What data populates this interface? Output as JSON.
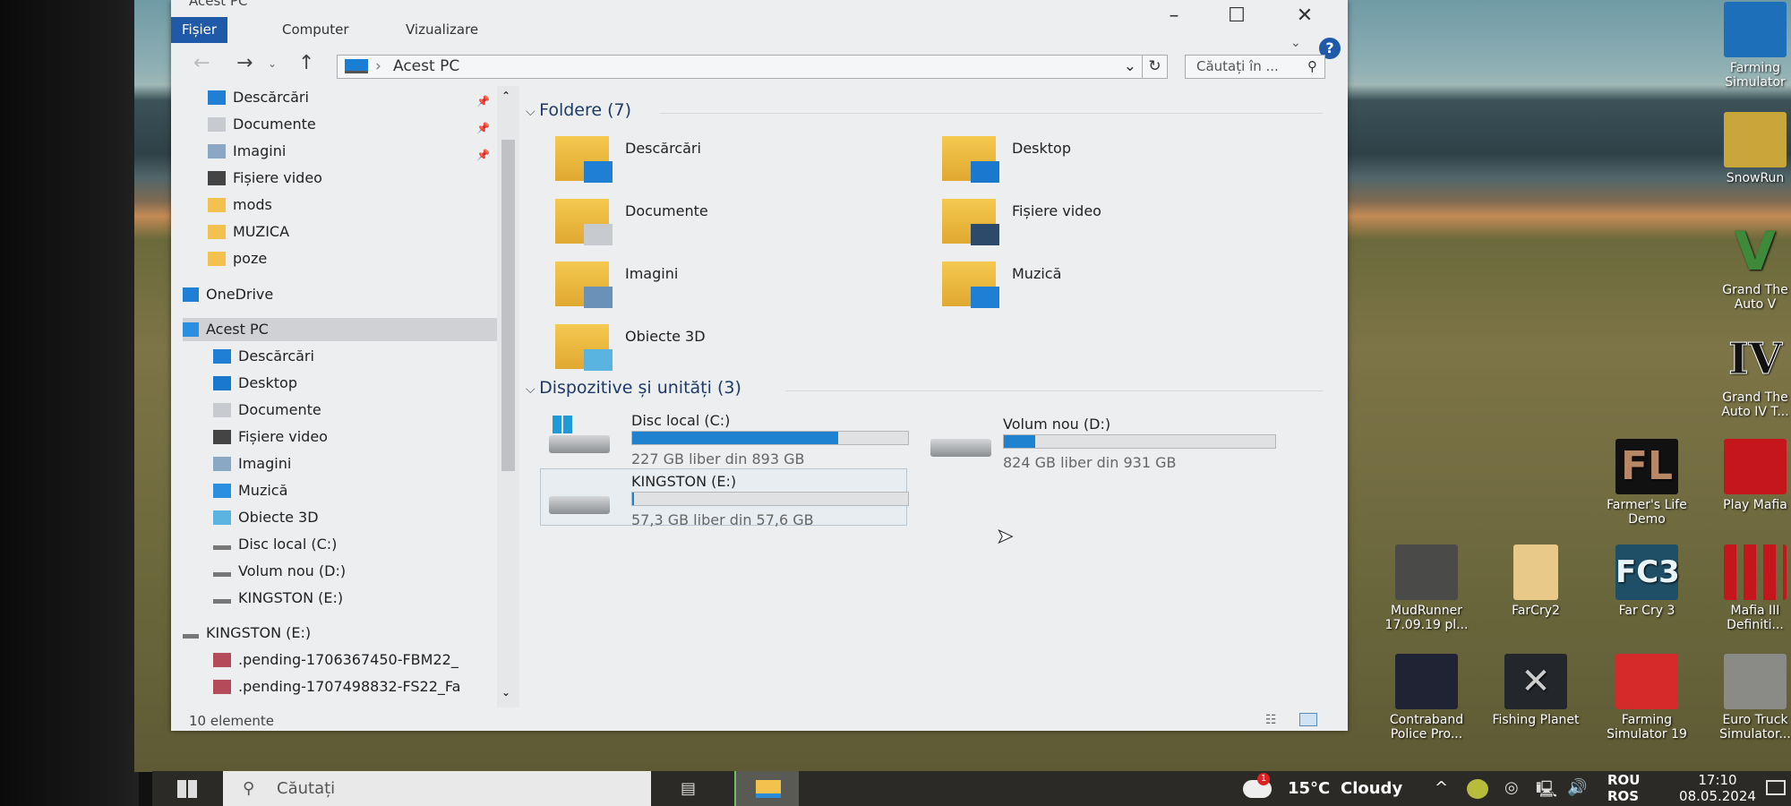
{
  "window": {
    "title": "Acest PC",
    "tabs": [
      {
        "label": "Fișier",
        "active": true
      },
      {
        "label": "Computer"
      },
      {
        "label": "Vizualizare"
      }
    ],
    "address": "Acest PC",
    "search_placeholder": "Căutați în ...",
    "status": "10 elemente"
  },
  "nav": [
    {
      "label": "Descărcări",
      "icon": "download-icon",
      "pinned": true
    },
    {
      "label": "Documente",
      "icon": "documents-icon",
      "pinned": true
    },
    {
      "label": "Imagini",
      "icon": "pictures-icon",
      "pinned": true
    },
    {
      "label": "Fișiere video",
      "icon": "video-icon"
    },
    {
      "label": "mods",
      "icon": "folder-icon"
    },
    {
      "label": "MUZICA",
      "icon": "folder-icon"
    },
    {
      "label": "poze",
      "icon": "folder-icon"
    },
    {
      "label": "OneDrive",
      "icon": "cloud-icon"
    },
    {
      "label": "Acest PC",
      "icon": "computer-icon",
      "selected": true
    },
    {
      "label": "Descărcări",
      "icon": "download-icon"
    },
    {
      "label": "Desktop",
      "icon": "desktop-icon"
    },
    {
      "label": "Documente",
      "icon": "documents-icon"
    },
    {
      "label": "Fișiere video",
      "icon": "video-icon"
    },
    {
      "label": "Imagini",
      "icon": "pictures-icon"
    },
    {
      "label": "Muzică",
      "icon": "music-icon"
    },
    {
      "label": "Obiecte 3D",
      "icon": "3d-objects-icon"
    },
    {
      "label": "Disc local (C:)",
      "icon": "drive-icon"
    },
    {
      "label": "Volum nou (D:)",
      "icon": "drive-icon"
    },
    {
      "label": "KINGSTON (E:)",
      "icon": "drive-icon"
    },
    {
      "label": "KINGSTON (E:)",
      "icon": "drive-icon"
    },
    {
      "label": ".pending-1706367450-FBM22_",
      "icon": "archive-icon"
    },
    {
      "label": ".pending-1707498832-FS22_Fa",
      "icon": "archive-icon"
    }
  ],
  "folders": {
    "header": "Foldere (7)",
    "items": [
      "Descărcări",
      "Desktop",
      "Documente",
      "Fișiere video",
      "Imagini",
      "Muzică",
      "Obiecte 3D"
    ]
  },
  "devices": {
    "header": "Dispozitive și unități (3)",
    "items": [
      {
        "name": "Disc local (C:)",
        "space": "227 GB liber din 893 GB",
        "used_fraction": 0.746
      },
      {
        "name": "Volum nou (D:)",
        "space": "824 GB liber din 931 GB",
        "used_fraction": 0.115
      },
      {
        "name": "KINGSTON (E:)",
        "space": "57,3 GB liber din 57,6 GB",
        "used_fraction": 0.005,
        "selected": true
      }
    ]
  },
  "desktop_icons": [
    "Farming Simulator",
    "SnowRun",
    "Grand The Auto V",
    "Grand The Auto IV T...",
    "Farmer's Life Demo",
    "Play Mafia",
    "MudRunner 17.09.19 pl...",
    "FarCry2",
    "Far Cry 3",
    "Mafia III Definiti...",
    "Contraband Police Pro...",
    "Fishing Planet",
    "Farming Simulator 19",
    "Euro Truck Simulator..."
  ],
  "taskbar": {
    "search_placeholder": "Căutați",
    "weather_temp": "15°C",
    "weather_text": "Cloudy",
    "weather_badge": "1",
    "lang_top": "ROU",
    "lang_bottom": "ROS",
    "time": "17:10",
    "date": "08.05.2024"
  },
  "colors": {
    "accent": "#1e5aa8",
    "bar_fill": "#1e82d0"
  }
}
